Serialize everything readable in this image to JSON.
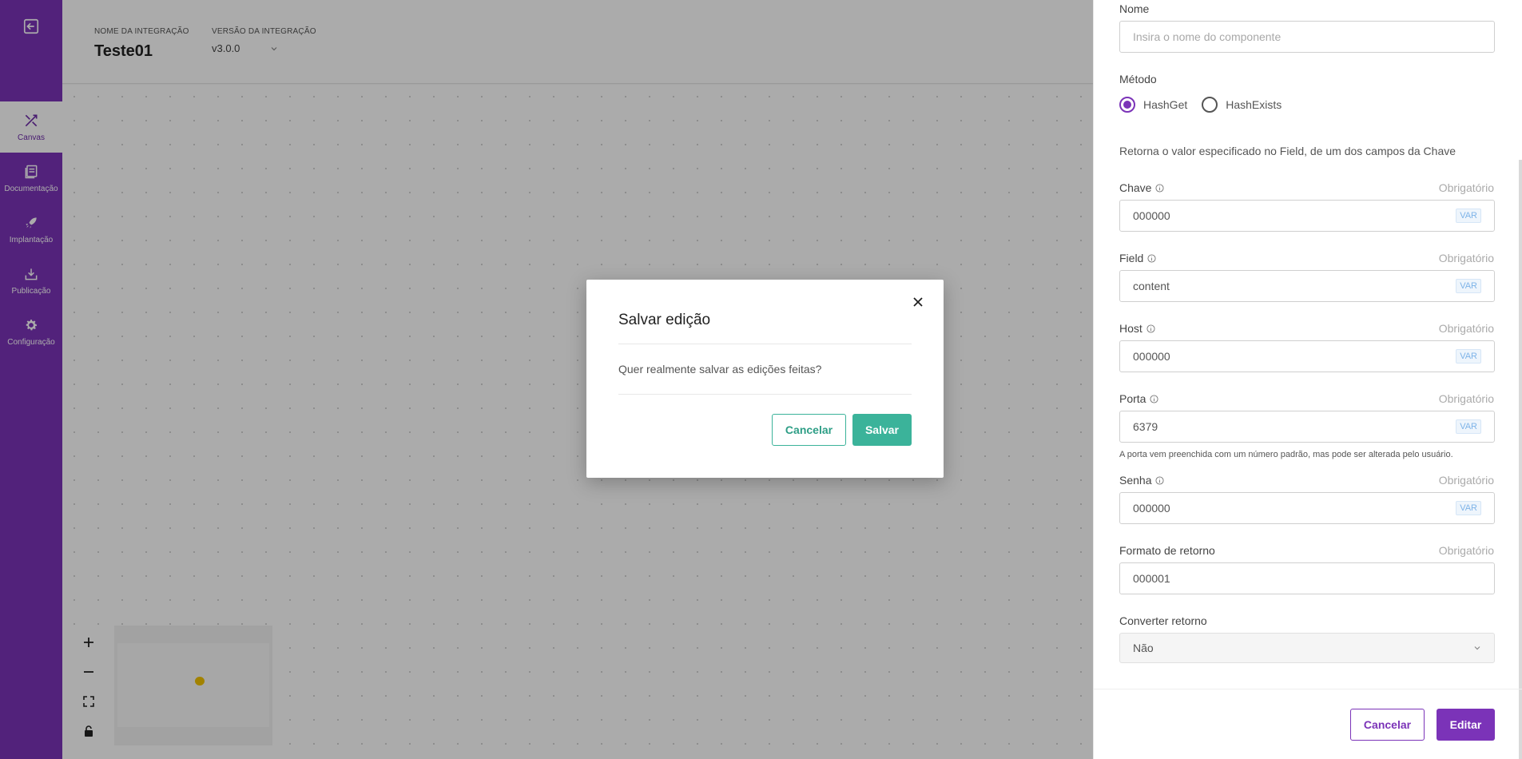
{
  "sidebar": {
    "items": [
      {
        "label": "Canvas",
        "icon": "canvas-tools-icon",
        "active": true
      },
      {
        "label": "Documentação",
        "icon": "document-icon"
      },
      {
        "label": "Implantação",
        "icon": "rocket-icon"
      },
      {
        "label": "Publicação",
        "icon": "download-tray-icon"
      },
      {
        "label": "Configuração",
        "icon": "gear-icon"
      }
    ]
  },
  "header": {
    "name_label": "NOME DA INTEGRAÇÃO",
    "name": "Teste01",
    "version_label": "VERSÃO DA INTEGRAÇÃO",
    "version": "v3.0.0"
  },
  "modal": {
    "title": "Salvar edição",
    "message": "Quer realmente salvar as edições feitas?",
    "cancel": "Cancelar",
    "save": "Salvar"
  },
  "panel": {
    "nome": {
      "label": "Nome",
      "placeholder": "Insira o nome do componente"
    },
    "metodo": {
      "label": "Método",
      "options": [
        "HashGet",
        "HashExists"
      ],
      "selected": "HashGet"
    },
    "description": "Retorna o valor especificado no Field, de um dos campos da Chave",
    "required_text": "Obrigatório",
    "var_badge": "VAR",
    "fields": [
      {
        "label": "Chave",
        "value": "000000"
      },
      {
        "label": "Field",
        "value": "content"
      },
      {
        "label": "Host",
        "value": "000000"
      },
      {
        "label": "Porta",
        "value": "6379"
      },
      {
        "label": "Senha",
        "value": "000000"
      }
    ],
    "porta_hint": "A porta vem preenchida com um número padrão, mas pode ser alterada pelo usuário.",
    "formato": {
      "label": "Formato de retorno",
      "value": "000001"
    },
    "converter": {
      "label": "Converter retorno",
      "value": "Não"
    },
    "cancel": "Cancelar",
    "edit": "Editar"
  },
  "colors": {
    "brand": "#7b33b8",
    "accent": "#3bb39a"
  }
}
